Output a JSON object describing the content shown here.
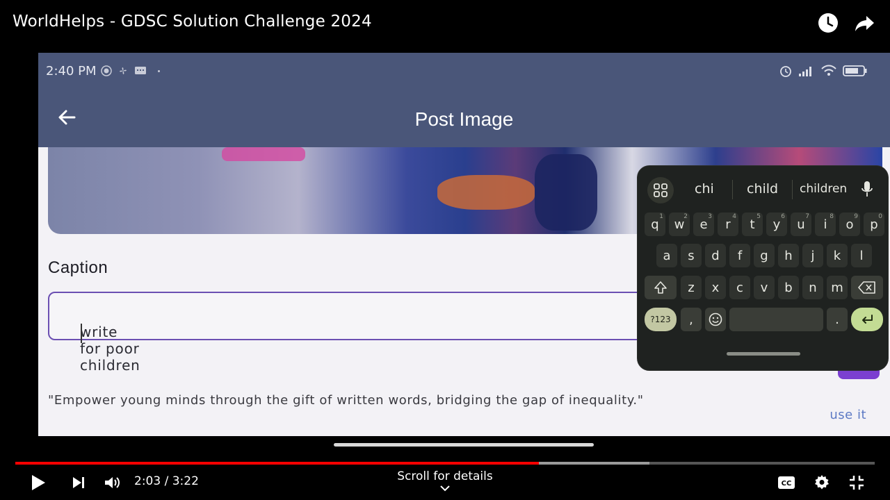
{
  "video": {
    "title": "WorldHelps - GDSC Solution Challenge 2024",
    "time_display": "2:03 / 3:22",
    "progress": 0.609,
    "buffered": 0.738,
    "scroll_hint": "Scroll for details"
  },
  "phone": {
    "status_time": "2:40 PM",
    "appbar_title": "Post Image",
    "caption_label": "Caption",
    "caption_value": "write for poor children",
    "quote": "\"Empower young minds through the gift of written words, bridging the gap of inequality.\"",
    "use_it": "use it"
  },
  "keyboard": {
    "suggestions": [
      "chi",
      "child",
      "children"
    ],
    "row1": [
      {
        "k": "q",
        "n": "1"
      },
      {
        "k": "w",
        "n": "2"
      },
      {
        "k": "e",
        "n": "3"
      },
      {
        "k": "r",
        "n": "4"
      },
      {
        "k": "t",
        "n": "5"
      },
      {
        "k": "y",
        "n": "6"
      },
      {
        "k": "u",
        "n": "7"
      },
      {
        "k": "i",
        "n": "8"
      },
      {
        "k": "o",
        "n": "9"
      },
      {
        "k": "p",
        "n": "0"
      }
    ],
    "row2": [
      "a",
      "s",
      "d",
      "f",
      "g",
      "h",
      "j",
      "k",
      "l"
    ],
    "row3": [
      "z",
      "x",
      "c",
      "v",
      "b",
      "n",
      "m"
    ],
    "num_key": "?123",
    "comma": ",",
    "period": "."
  },
  "colors": {
    "appbar": "#4a5679",
    "progress": "#ff0000",
    "accent_purple": "#6b4fb2",
    "enter_key": "#c3dc94"
  }
}
